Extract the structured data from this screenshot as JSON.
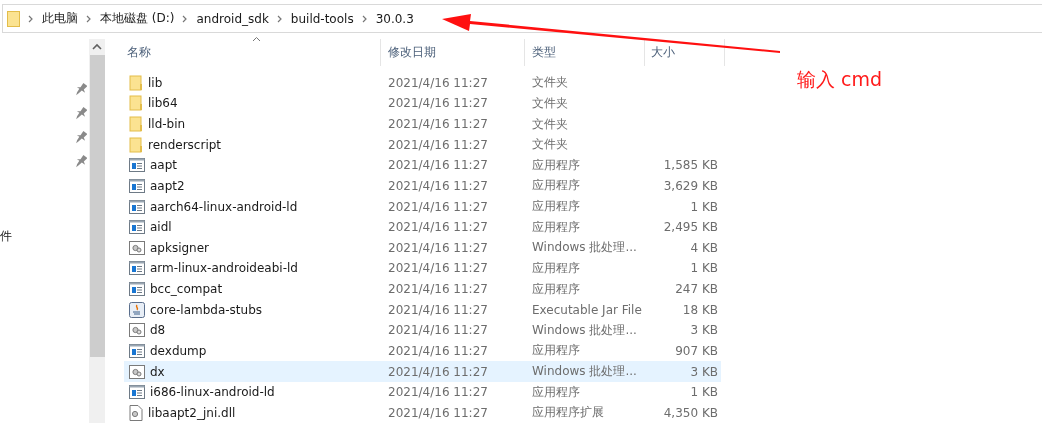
{
  "address_bar": {
    "path": [
      "此电脑",
      "本地磁盘 (D:)",
      "android_sdk",
      "build-tools",
      "30.0.3"
    ]
  },
  "nav_pane": {
    "items": [
      "件"
    ]
  },
  "table": {
    "columns": [
      {
        "label": "名称",
        "sorted": true
      },
      {
        "label": "修改日期",
        "sorted": false
      },
      {
        "label": "类型",
        "sorted": false
      },
      {
        "label": "大小",
        "sorted": false
      }
    ],
    "rows": [
      {
        "kind": "folder",
        "name": "lib",
        "date": "2021/4/16 11:27",
        "type": "文件夹",
        "selected": false
      },
      {
        "kind": "folder",
        "name": "lib64",
        "date": "2021/4/16 11:27",
        "type": "文件夹",
        "selected": false
      },
      {
        "kind": "folder",
        "name": "lld-bin",
        "date": "2021/4/16 11:27",
        "type": "文件夹",
        "selected": false
      },
      {
        "kind": "folder",
        "name": "renderscript",
        "date": "2021/4/16 11:27",
        "type": "文件夹",
        "selected": false
      },
      {
        "kind": "exe",
        "name": "aapt",
        "date": "2021/4/16 11:27",
        "type": "应用程序",
        "size": "1,585 KB",
        "selected": false
      },
      {
        "kind": "exe",
        "name": "aapt2",
        "date": "2021/4/16 11:27",
        "type": "应用程序",
        "size": "3,629 KB",
        "selected": false
      },
      {
        "kind": "exe",
        "name": "aarch64-linux-android-ld",
        "date": "2021/4/16 11:27",
        "type": "应用程序",
        "size": "1 KB",
        "selected": false
      },
      {
        "kind": "exe",
        "name": "aidl",
        "date": "2021/4/16 11:27",
        "type": "应用程序",
        "size": "2,495 KB",
        "selected": false
      },
      {
        "kind": "batch",
        "name": "apksigner",
        "date": "2021/4/16 11:27",
        "type": "Windows 批处理...",
        "size": "4 KB",
        "selected": false
      },
      {
        "kind": "exe",
        "name": "arm-linux-androideabi-ld",
        "date": "2021/4/16 11:27",
        "type": "应用程序",
        "size": "1 KB",
        "selected": false
      },
      {
        "kind": "exe",
        "name": "bcc_compat",
        "date": "2021/4/16 11:27",
        "type": "应用程序",
        "size": "247 KB",
        "selected": false
      },
      {
        "kind": "jar",
        "name": "core-lambda-stubs",
        "date": "2021/4/16 11:27",
        "type": "Executable Jar File",
        "size": "18 KB",
        "selected": false
      },
      {
        "kind": "batch",
        "name": "d8",
        "date": "2021/4/16 11:27",
        "type": "Windows 批处理...",
        "size": "3 KB",
        "selected": false
      },
      {
        "kind": "exe",
        "name": "dexdump",
        "date": "2021/4/16 11:27",
        "type": "应用程序",
        "size": "907 KB",
        "selected": false
      },
      {
        "kind": "batch",
        "name": "dx",
        "date": "2021/4/16 11:27",
        "type": "Windows 批处理...",
        "size": "3 KB",
        "selected": true
      },
      {
        "kind": "exe",
        "name": "i686-linux-android-ld",
        "date": "2021/4/16 11:27",
        "type": "应用程序",
        "size": "1 KB",
        "selected": false
      },
      {
        "kind": "dll",
        "name": "libaapt2_jni.dll",
        "date": "2021/4/16 11:27",
        "type": "应用程序扩展",
        "size": "4,350 KB",
        "selected": false
      }
    ]
  },
  "annotation": {
    "text": "输入 cmd"
  }
}
